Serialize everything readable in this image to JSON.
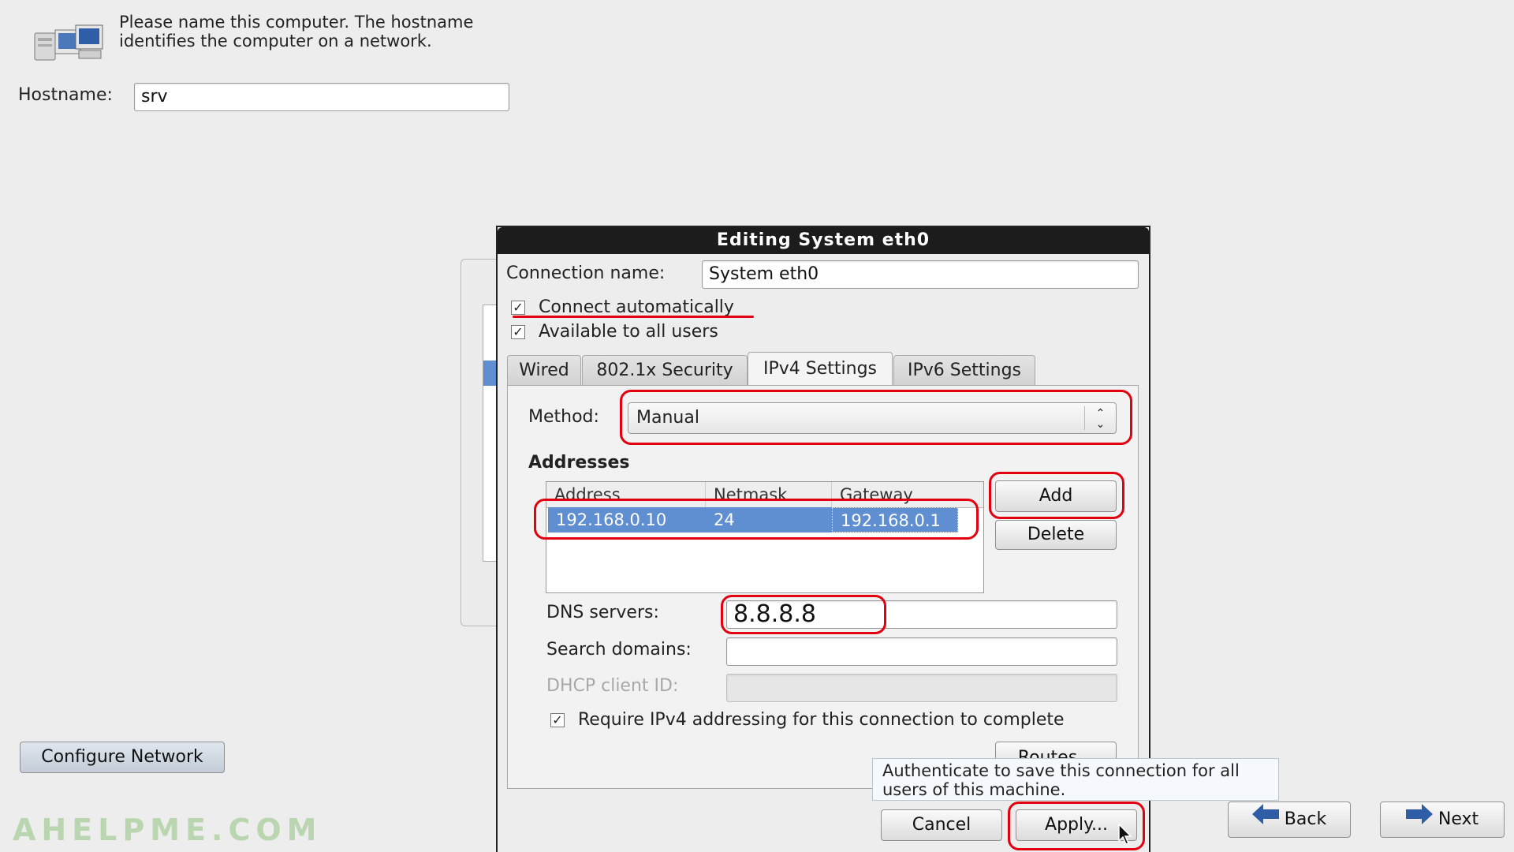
{
  "header": {
    "description": "Please name this computer.  The hostname identifies the computer on a network.",
    "hostname_label": "Hostname:",
    "hostname_value": "srv"
  },
  "configure_network_label": "Configure Network",
  "watermark": "AHELPME.COM",
  "nav": {
    "back_label": "Back",
    "next_label": "Next"
  },
  "dialog": {
    "title": "Editing System eth0",
    "connection_name_label": "Connection name:",
    "connection_name_value": "System eth0",
    "connect_automatically_label": "Connect automatically",
    "available_all_users_label": "Available to all users",
    "tabs": [
      {
        "label": "Wired"
      },
      {
        "label": "802.1x Security"
      },
      {
        "label": "IPv4 Settings"
      },
      {
        "label": "IPv6 Settings"
      }
    ],
    "method_label": "Method:",
    "method_value": "Manual",
    "addresses_heading": "Addresses",
    "columns": [
      "Address",
      "Netmask",
      "Gateway"
    ],
    "rows": [
      {
        "address": "192.168.0.10",
        "netmask": "24",
        "gateway": "192.168.0.1"
      }
    ],
    "add_label": "Add",
    "delete_label": "Delete",
    "dns_label": "DNS servers:",
    "dns_value": "8.8.8.8",
    "search_domains_label": "Search domains:",
    "search_domains_value": "",
    "dhcp_client_label": "DHCP client ID:",
    "dhcp_client_value": "",
    "require_ipv4_label": "Require IPv4 addressing for this connection to complete",
    "routes_label": "Routes...",
    "tooltip": "Authenticate to save this connection for all users of this machine.",
    "cancel_label": "Cancel",
    "apply_label": "Apply..."
  },
  "colors": {
    "highlight_row": "#5f8fd1",
    "annotation_red": "#e3000f",
    "title_bar": "#1c1c1c",
    "tooltip_bg": "#f5f9fd"
  },
  "icons": [
    "computer-network-icon",
    "checkbox-checked-icon",
    "combo-arrows-icon",
    "arrow-left-icon",
    "arrow-right-icon",
    "mouse-cursor-icon"
  ]
}
